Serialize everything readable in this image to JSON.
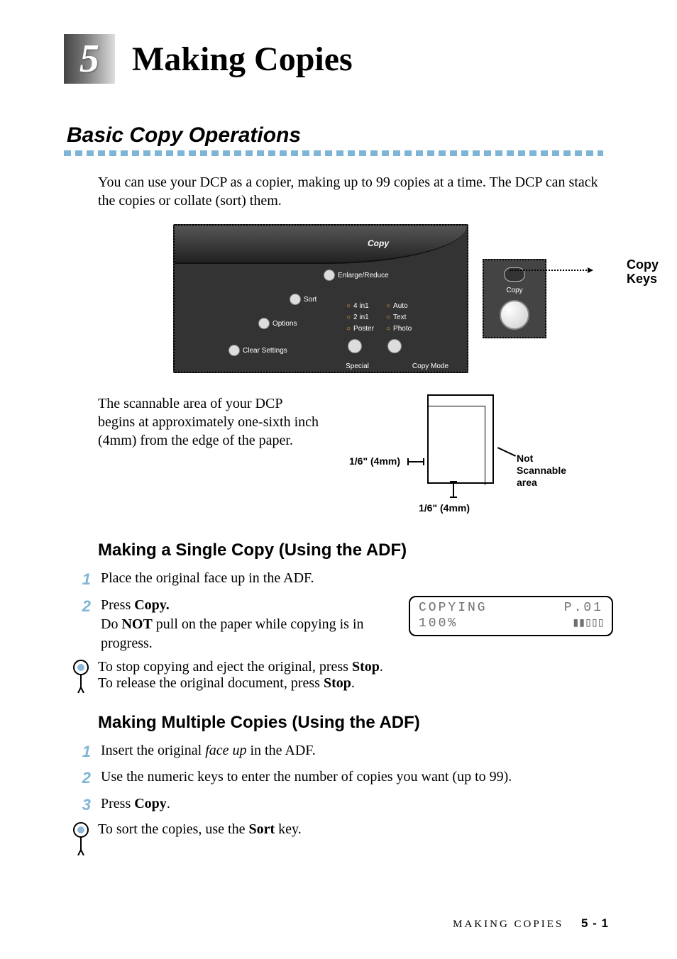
{
  "chapter": {
    "number": "5",
    "title": "Making Copies"
  },
  "section": {
    "title": "Basic Copy Operations"
  },
  "intro": "You can use your DCP as a copier, making up to 99 copies at a time. The DCP can stack the copies or collate (sort) them.",
  "panel": {
    "copy": "Copy",
    "enlarge": "Enlarge/Reduce",
    "sort": "Sort",
    "options": "Options",
    "clear": "Clear Settings",
    "four": "4 in1",
    "two": "2 in1",
    "poster": "Poster",
    "auto": "Auto",
    "text": "Text",
    "photo": "Photo",
    "special": "Special",
    "copymode": "Copy Mode"
  },
  "copy_keys_label": "Copy\nKeys",
  "copy_btn_text": "Copy",
  "scan": {
    "text": "The scannable area of your DCP begins at approximately one-sixth inch (4mm) from the edge of the paper.",
    "left": "1/6\" (4mm)",
    "bottom": "1/6\" (4mm)",
    "right": "Not\nScannable\narea"
  },
  "single": {
    "heading": "Making a Single Copy (Using the ADF)",
    "s1": "Place the original face up in the ADF.",
    "s2_a": "Press ",
    "s2_b": "Copy.",
    "s2_c": "Do ",
    "s2_d": "NOT",
    "s2_e": " pull on the paper while copying is in progress."
  },
  "lcd": {
    "r1a": "COPYING",
    "r1b": "P.01",
    "r2a": "100%",
    "r2b": "▮▮▯▯▯"
  },
  "note1": {
    "a": "To stop copying and eject the original, press ",
    "b": "Stop",
    "c": ".",
    "d": "To release the original document, press ",
    "e": "Stop",
    "f": "."
  },
  "multi": {
    "heading": "Making Multiple Copies (Using the ADF)",
    "s1_a": "Insert the original ",
    "s1_b": "face up",
    "s1_c": " in the ADF.",
    "s2": "Use the numeric keys to enter the number of copies you want (up to 99).",
    "s3_a": "Press ",
    "s3_b": "Copy",
    "s3_c": "."
  },
  "note2": {
    "a": "To sort the copies, use the ",
    "b": "Sort",
    "c": " key."
  },
  "footer": {
    "running": "MAKING COPIES",
    "page": "5 - 1"
  }
}
